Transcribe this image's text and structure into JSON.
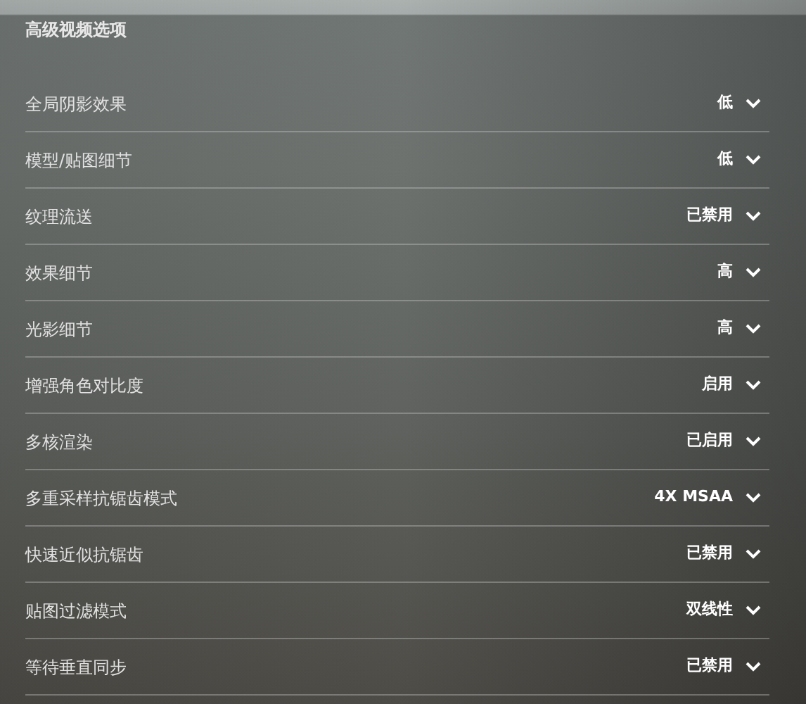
{
  "section_title": "高级视频选项",
  "settings": [
    {
      "label": "全局阴影效果",
      "value": "低"
    },
    {
      "label": "模型/贴图细节",
      "value": "低"
    },
    {
      "label": "纹理流送",
      "value": "已禁用"
    },
    {
      "label": "效果细节",
      "value": "高"
    },
    {
      "label": "光影细节",
      "value": "高"
    },
    {
      "label": "增强角色对比度",
      "value": "启用"
    },
    {
      "label": "多核渲染",
      "value": "已启用"
    },
    {
      "label": "多重采样抗锯齿模式",
      "value": "4X MSAA"
    },
    {
      "label": "快速近似抗锯齿",
      "value": "已禁用"
    },
    {
      "label": "贴图过滤模式",
      "value": "双线性"
    },
    {
      "label": "等待垂直同步",
      "value": "已禁用"
    }
  ]
}
